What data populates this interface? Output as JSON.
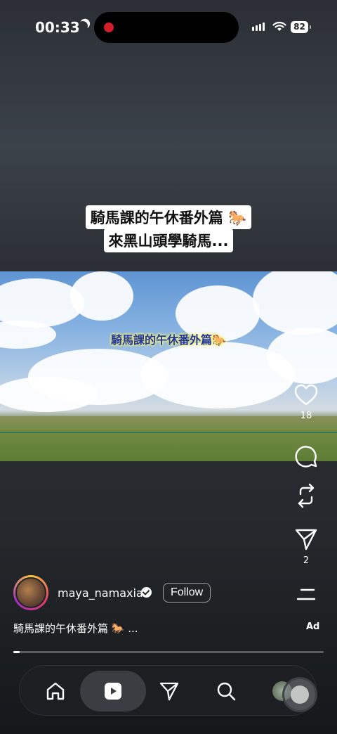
{
  "status_bar": {
    "time": "00:33",
    "battery": "82"
  },
  "post": {
    "caption_line1": "騎馬課的午休番外篇 🐎",
    "caption_line2": "來黑山頭學騎馬...",
    "video_overlay_text": "騎馬課的午休番外篇🐎",
    "username": "maya_namaxia",
    "follow_label": "Follow",
    "description": "騎馬課的午休番外篇 🐎 ...",
    "ad_label": "Ad",
    "progress": 0.02
  },
  "actions": {
    "likes": "18",
    "shares": "2"
  },
  "icons": {
    "like": "heart-icon",
    "comment": "comment-icon",
    "repost": "repost-icon",
    "share": "send-icon",
    "more": "more-icon",
    "nav": [
      "home-icon",
      "reels-icon",
      "send-icon",
      "search-icon",
      "profile-icon"
    ]
  },
  "colors": {
    "record_indicator": "#d21d2a",
    "background": "#26292d"
  }
}
